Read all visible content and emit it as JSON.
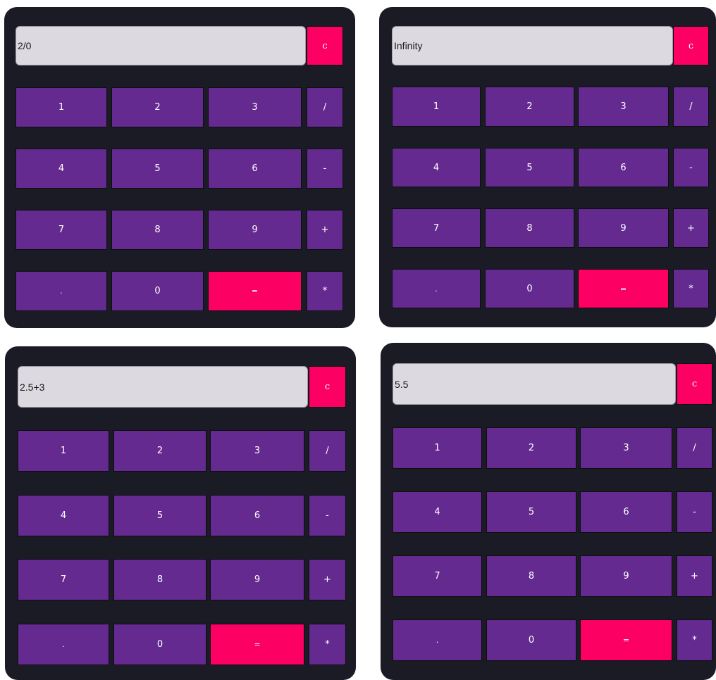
{
  "colors": {
    "panel": "#1b1b26",
    "display": "#dcdae0",
    "key": "#652a8f",
    "accent": "#fc0064",
    "key_text": "#ffffff"
  },
  "calculators": [
    {
      "display": "2/0",
      "clear_label": "c",
      "rows": [
        [
          "1",
          "2",
          "3",
          "/"
        ],
        [
          "4",
          "5",
          "6",
          "-"
        ],
        [
          "7",
          "8",
          "9",
          "+"
        ],
        [
          ".",
          "0",
          "=",
          "*"
        ]
      ]
    },
    {
      "display": "Infinity",
      "clear_label": "c",
      "rows": [
        [
          "1",
          "2",
          "3",
          "/"
        ],
        [
          "4",
          "5",
          "6",
          "-"
        ],
        [
          "7",
          "8",
          "9",
          "+"
        ],
        [
          ".",
          "0",
          "=",
          "*"
        ]
      ]
    },
    {
      "display": "2.5+3",
      "clear_label": "c",
      "rows": [
        [
          "1",
          "2",
          "3",
          "/"
        ],
        [
          "4",
          "5",
          "6",
          "-"
        ],
        [
          "7",
          "8",
          "9",
          "+"
        ],
        [
          ".",
          "0",
          "=",
          "*"
        ]
      ]
    },
    {
      "display": "5.5",
      "clear_label": "c",
      "rows": [
        [
          "1",
          "2",
          "3",
          "/"
        ],
        [
          "4",
          "5",
          "6",
          "-"
        ],
        [
          "7",
          "8",
          "9",
          "+"
        ],
        [
          ".",
          "0",
          "=",
          "*"
        ]
      ]
    }
  ]
}
